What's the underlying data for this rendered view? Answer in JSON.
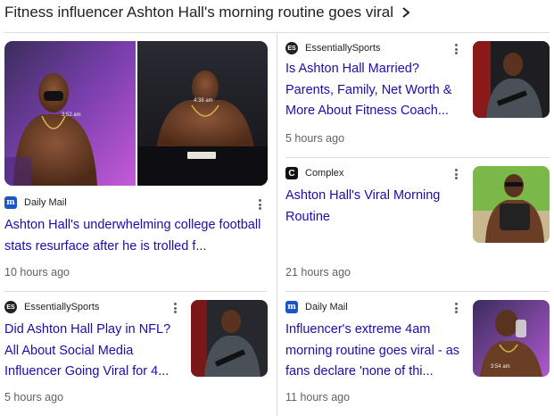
{
  "header": {
    "title": "Fitness influencer Ashton Hall's morning routine goes viral"
  },
  "featured": {
    "image_left_timestamp": "3:52 am",
    "image_right_timestamp": "4:38 am",
    "source": "Daily Mail",
    "source_logo": "m",
    "headline": "Ashton Hall's underwhelming college football stats resurface after he is trolled f...",
    "time": "10 hours ago"
  },
  "right_top": [
    {
      "source": "EssentiallySports",
      "source_logo": "ES",
      "headline": "Is Ashton Hall Married? Parents, Family, Net Worth & More About Fitness Coach...",
      "time": "5 hours ago"
    },
    {
      "source": "Complex",
      "source_logo": "C",
      "headline": "Ashton Hall's Viral Morning Routine",
      "time": "21 hours ago"
    }
  ],
  "bottom": [
    {
      "source": "EssentiallySports",
      "source_logo": "ES",
      "headline": "Did Ashton Hall Play in NFL? All About Social Media Influencer Going Viral for 4...",
      "time": "5 hours ago"
    },
    {
      "source": "Daily Mail",
      "source_logo": "m",
      "headline": "Influencer's extreme 4am morning routine goes viral - as fans declare 'none of thi...",
      "time": "11 hours ago",
      "image_timestamp": "3:54 am"
    }
  ],
  "colors": {
    "link": "#1a0dab",
    "meta": "#5f6368",
    "divider": "#dadce0"
  }
}
